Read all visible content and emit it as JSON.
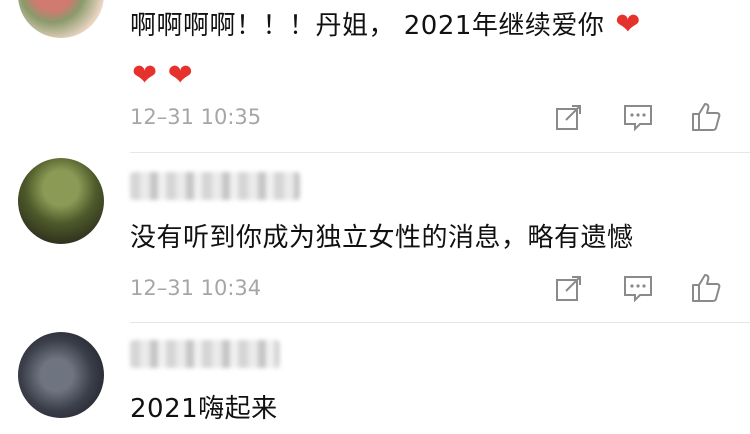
{
  "comments": [
    {
      "text": "啊啊啊啊！！！丹姐， 2021年继续爱你",
      "hearts_inline": "❤",
      "hearts_line2": "❤ ❤",
      "timestamp": "12–31 10:35",
      "avatar_colors": [
        "#d07a70",
        "#8a9a6b",
        "#f0d9c9"
      ]
    },
    {
      "text": "没有听到你成为独立女性的消息，略有遗憾",
      "timestamp": "12–31 10:34",
      "avatar_colors": [
        "#4e5a2a",
        "#8b9a55",
        "#2a2a1c"
      ]
    },
    {
      "text": "2021嗨起来",
      "avatar_colors": [
        "#3b3f4a",
        "#6e7480",
        "#1f2026"
      ]
    }
  ],
  "icons": {
    "share": "share-icon",
    "comment": "comment-icon",
    "like": "like-icon"
  }
}
